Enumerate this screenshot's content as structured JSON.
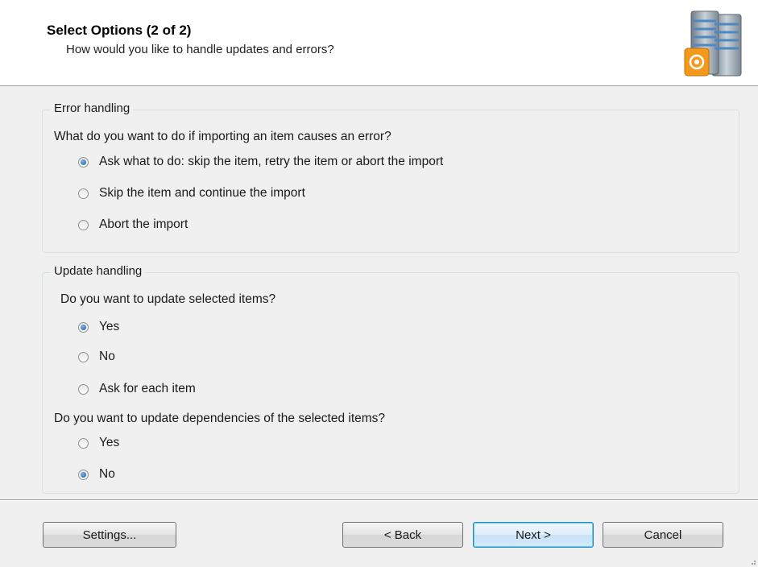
{
  "header": {
    "title": "Select Options (2 of 2)",
    "subtitle": "How would you like to handle updates and errors?",
    "icon": "database-server-icon"
  },
  "error_handling": {
    "group_title": "Error handling",
    "question": "What do you want to do if importing an item causes an error?",
    "options": [
      {
        "label": "Ask what to do: skip the item, retry the item or abort the import",
        "selected": true
      },
      {
        "label": "Skip the item and continue the import",
        "selected": false
      },
      {
        "label": "Abort the import",
        "selected": false
      }
    ]
  },
  "update_handling": {
    "group_title": "Update handling",
    "question_items": "Do you want to update selected items?",
    "items_options": [
      {
        "label": "Yes",
        "selected": true
      },
      {
        "label": "No",
        "selected": false
      },
      {
        "label": "Ask for each item",
        "selected": false
      }
    ],
    "question_dependencies": "Do you want to update dependencies of the selected items?",
    "dependencies_options": [
      {
        "label": "Yes",
        "selected": false
      },
      {
        "label": "No",
        "selected": true
      }
    ]
  },
  "buttons": {
    "settings": "Settings...",
    "back": "< Back",
    "next": "Next >",
    "cancel": "Cancel"
  }
}
